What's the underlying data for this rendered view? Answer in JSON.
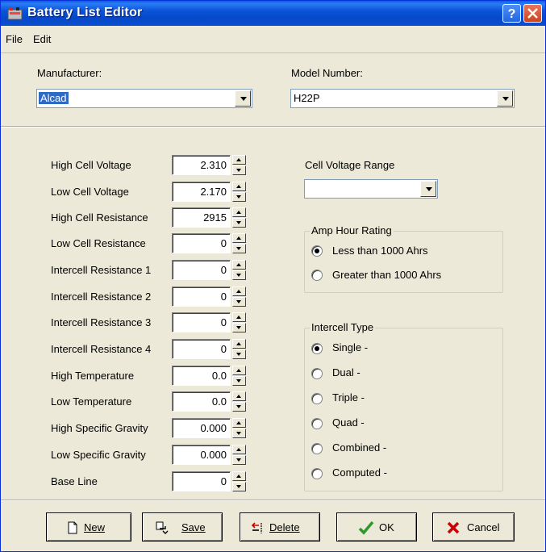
{
  "window": {
    "title": "Battery List Editor"
  },
  "menu": {
    "file": "File",
    "edit": "Edit"
  },
  "manufacturer": {
    "label": "Manufacturer:",
    "value": "Alcad"
  },
  "model": {
    "label": "Model Number:",
    "value": "H22P"
  },
  "fields": [
    {
      "label": "High Cell Voltage",
      "value": "2.310"
    },
    {
      "label": "Low Cell Voltage",
      "value": "2.170"
    },
    {
      "label": "High Cell Resistance",
      "value": "2915"
    },
    {
      "label": "Low Cell Resistance",
      "value": "0"
    },
    {
      "label": "Intercell Resistance 1",
      "value": "0"
    },
    {
      "label": "Intercell Resistance 2",
      "value": "0"
    },
    {
      "label": "Intercell Resistance 3",
      "value": "0"
    },
    {
      "label": "Intercell Resistance 4",
      "value": "0"
    },
    {
      "label": "High Temperature",
      "value": "0.0"
    },
    {
      "label": "Low Temperature",
      "value": "0.0"
    },
    {
      "label": "High Specific Gravity",
      "value": "0.000"
    },
    {
      "label": "Low Specific Gravity",
      "value": "0.000"
    },
    {
      "label": "Base Line",
      "value": "0"
    }
  ],
  "cell_voltage_range": {
    "label": "Cell Voltage Range",
    "value": ""
  },
  "amp_hour": {
    "title": "Amp Hour Rating",
    "options": [
      {
        "label": "Less than 1000 Ahrs",
        "selected": true
      },
      {
        "label": "Greater than 1000 Ahrs",
        "selected": false
      }
    ]
  },
  "intercell": {
    "title": "Intercell Type",
    "options": [
      {
        "label": "Single  -",
        "selected": true
      },
      {
        "label": "Dual  -",
        "selected": false
      },
      {
        "label": "Triple  -",
        "selected": false
      },
      {
        "label": "Quad  -",
        "selected": false
      },
      {
        "label": "Combined  -",
        "selected": false
      },
      {
        "label": "Computed  -",
        "selected": false
      }
    ]
  },
  "buttons": {
    "new": "New",
    "save": "Save",
    "delete": "Delete",
    "ok": "OK",
    "cancel": "Cancel"
  },
  "colors": {
    "title_bar": "#0a54d8",
    "face": "#ece9d8",
    "selection": "#316ac5"
  }
}
